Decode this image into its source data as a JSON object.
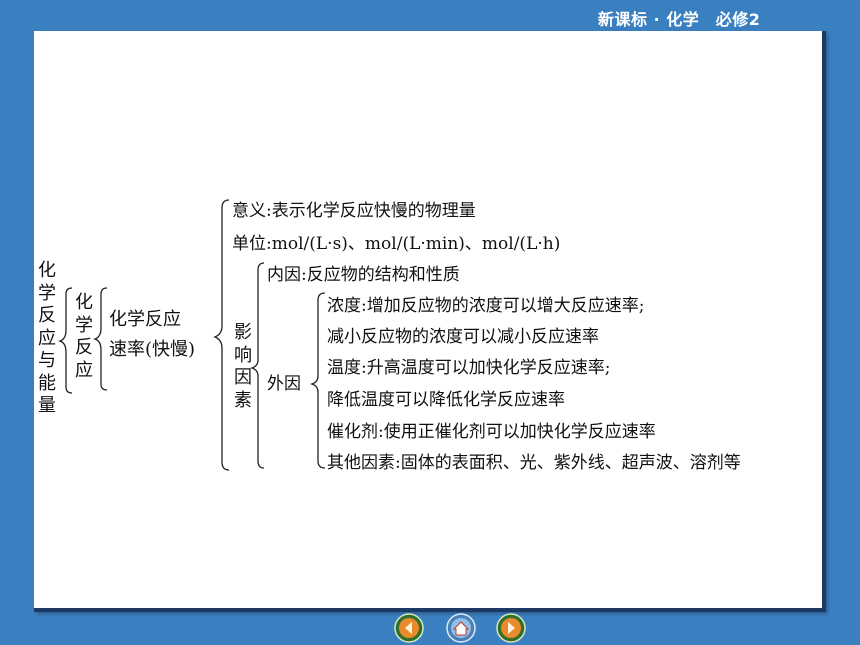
{
  "header": {
    "title": "新课标 · 化学　必修2"
  },
  "root": {
    "label": "化学反应与能量"
  },
  "level1": {
    "label": "化学反应"
  },
  "level2": {
    "line1": "化学反应",
    "line2": "速率(快慢)"
  },
  "meaning": "意义:表示化学反应快慢的物理量",
  "unit": "单位:mol/(L·s)、mol/(L·min)、mol/(L·h)",
  "factors": {
    "label": "影响因素",
    "internal": "内因:反应物的结构和性质",
    "external": {
      "label": "外因",
      "items": [
        "浓度:增加反应物的浓度可以增大反应速率;",
        "减小反应物的浓度可以减小反应速率",
        "温度:升高温度可以加快化学反应速率;",
        "降低温度可以降低化学反应速率",
        "催化剂:使用正催化剂可以加快化学反应速率",
        "其他因素:固体的表面积、光、紫外线、超声波、溶剂等"
      ]
    }
  },
  "nav": [
    "prev-icon",
    "home-icon",
    "next-icon"
  ],
  "colors": {
    "background": "#3a7fc0",
    "panel": "#ffffff",
    "text": "#111111"
  }
}
